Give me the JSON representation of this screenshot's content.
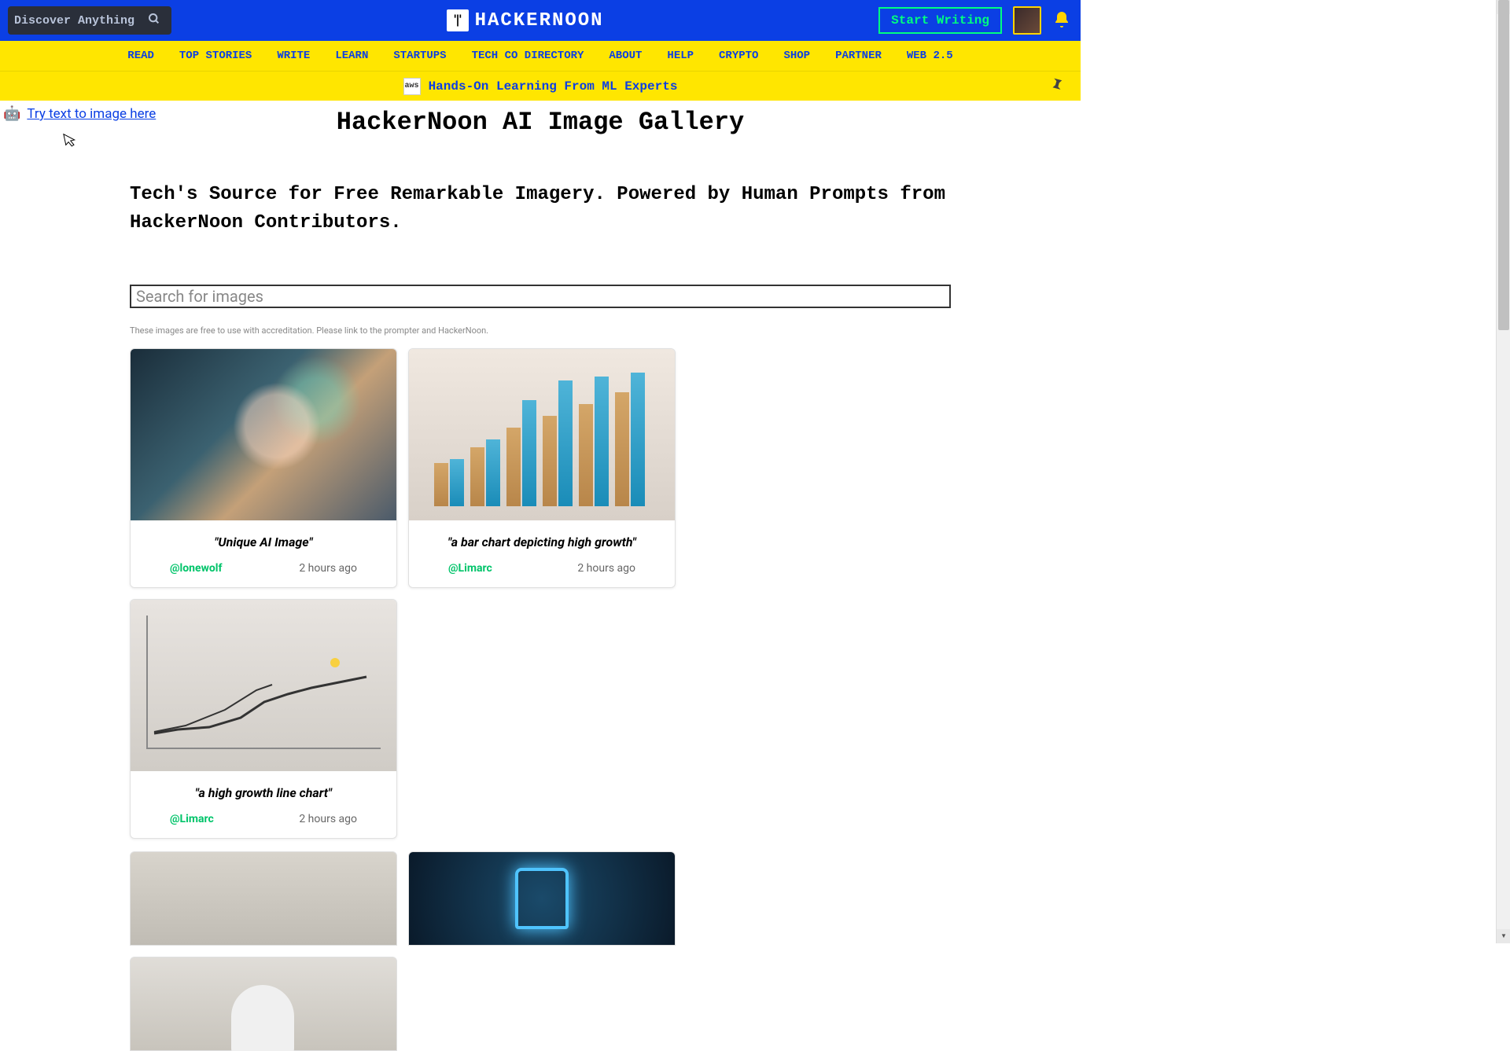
{
  "header": {
    "search_placeholder": "Discover Anything",
    "logo_text": "HACKERNOON",
    "start_writing": "Start Writing"
  },
  "nav": {
    "items": [
      "READ",
      "TOP STORIES",
      "WRITE",
      "LEARN",
      "STARTUPS",
      "TECH CO DIRECTORY",
      "ABOUT",
      "HELP",
      "CRYPTO",
      "SHOP",
      "PARTNER",
      "WEB 2.5"
    ]
  },
  "promo": {
    "icon_label": "aws",
    "text": "Hands-On Learning From ML Experts"
  },
  "try_link": {
    "emoji": "🤖",
    "text": "Try text to image here"
  },
  "page": {
    "title": "HackerNoon AI Image Gallery",
    "subtitle": "Tech's Source for Free Remarkable Imagery. Powered by Human Prompts from HackerNoon Contributors.",
    "img_search_placeholder": "Search for images",
    "disclaimer": "These images are free to use with accreditation. Please link to the prompter and HackerNoon."
  },
  "cards": [
    {
      "caption": "\"Unique AI Image\"",
      "author": "@lonewolf",
      "time": "2 hours ago"
    },
    {
      "caption": "\"a bar chart depicting high growth\"",
      "author": "@Limarc",
      "time": "2 hours ago"
    },
    {
      "caption": "\"a high growth line chart\"",
      "author": "@Limarc",
      "time": "2 hours ago"
    }
  ]
}
